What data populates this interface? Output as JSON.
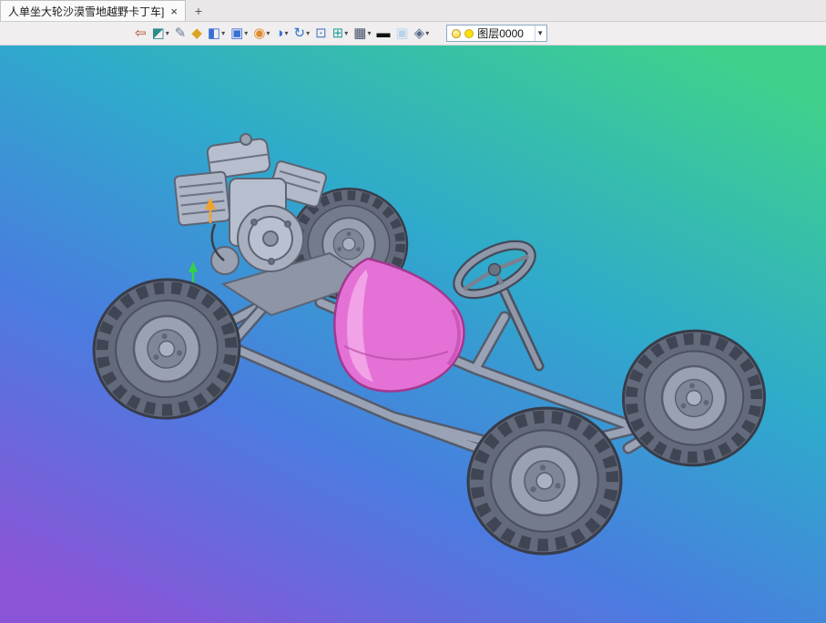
{
  "window": {
    "tab": {
      "title": "人单坐大轮沙漠雪地越野卡丁车]",
      "close_glyph": "×"
    },
    "new_tab_glyph": "+"
  },
  "toolbar": {
    "dropdown_glyph": "▾",
    "icons": [
      {
        "name": "view-back",
        "glyph": "⇦"
      },
      {
        "name": "camera-view",
        "glyph": "◩"
      },
      {
        "name": "color-picker",
        "glyph": "✎"
      },
      {
        "name": "render-tool",
        "glyph": "◆"
      },
      {
        "name": "shaded-display",
        "glyph": "◧"
      },
      {
        "name": "wireframe-display",
        "glyph": "▣"
      },
      {
        "name": "material-sphere",
        "glyph": "◉"
      },
      {
        "name": "display-mode",
        "glyph": "◑"
      },
      {
        "name": "rotate-view",
        "glyph": "↻"
      },
      {
        "name": "viewport-box",
        "glyph": "⊡"
      },
      {
        "name": "grid",
        "glyph": "⊞"
      },
      {
        "name": "screen-display",
        "glyph": "▦"
      },
      {
        "name": "line-width",
        "glyph": "▬"
      },
      {
        "name": "background-color",
        "glyph": "▣"
      },
      {
        "name": "layer-display",
        "glyph": "◈"
      }
    ],
    "layer": {
      "selected": "图层0000"
    }
  },
  "viewport": {
    "background": {
      "stop_top_right": "#3fd18c",
      "stop_upper_mid": "#2fa9cc",
      "stop_lower_mid": "#4a7ce0",
      "stop_bottom_left": "#8a54d8"
    },
    "model": {
      "seat_color": "#e472d6",
      "seat_highlight": "#f4aae9",
      "tire_color": "#636a7c",
      "tread_color": "#3f4552",
      "rim_color": "#99a1b3",
      "frame_color": "#9aa3b5",
      "frame_edge": "#565e70",
      "engine_color": "#b4bbca"
    }
  }
}
